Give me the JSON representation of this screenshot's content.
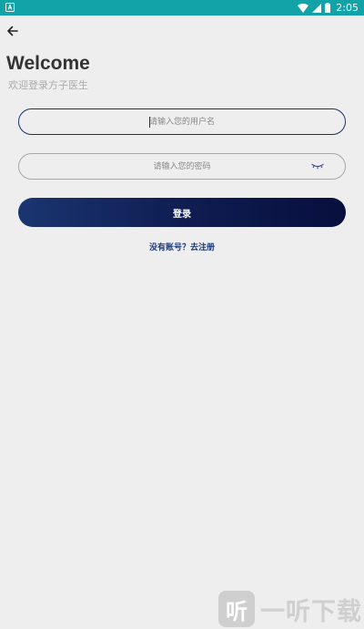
{
  "status_bar": {
    "time": "2:05",
    "notification_icon": "notification-a-icon",
    "icons": [
      "wifi-icon",
      "cell-signal-icon",
      "battery-icon"
    ],
    "background_color": "#12a3a8"
  },
  "header": {
    "back_icon": "arrow-left-icon"
  },
  "welcome": {
    "title": "Welcome",
    "subtitle": "欢迎登录方子医生"
  },
  "form": {
    "username": {
      "placeholder": "请输入您的用户名",
      "value": "",
      "focused": true
    },
    "password": {
      "placeholder": "请输入您的密码",
      "value": "",
      "visibility_icon": "eye-closed-icon"
    },
    "login_label": "登录",
    "register_link": "没有账号？去注册"
  },
  "colors": {
    "accent": "#1d2f6e",
    "button_gradient_start": "#1a3570",
    "button_gradient_end": "#070f3d",
    "link": "#1b3a78"
  },
  "watermark": {
    "logo_char": "听",
    "text": "一听下载"
  }
}
